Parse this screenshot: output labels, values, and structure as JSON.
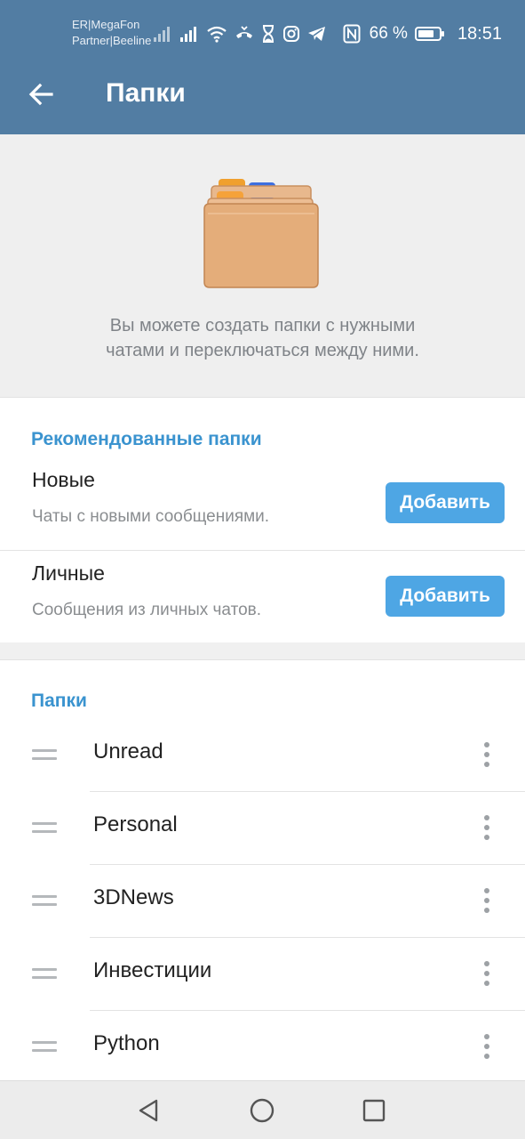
{
  "status_bar": {
    "carrier_line1": "ER|MegaFon",
    "carrier_line2": "Partner|Beeline",
    "battery_percent": "66 %",
    "time": "18:51",
    "icons": [
      "signal-r-icon",
      "signal-r-icon",
      "wifi-icon",
      "call-icon",
      "hourglass-icon",
      "instagram-icon",
      "telegram-icon",
      "nfc-icon",
      "battery-icon"
    ]
  },
  "header": {
    "title": "Папки",
    "back_icon": "arrow-left-icon",
    "background_color": "#527da3"
  },
  "hero": {
    "illustration": "folders-illustration",
    "text_line1": "Вы можете создать папки с нужными",
    "text_line2": "чатами и переключаться между ними."
  },
  "recommended": {
    "title": "Рекомендованные папки",
    "items": [
      {
        "name": "Новые",
        "description": "Чаты с новыми сообщениями.",
        "button": "Добавить"
      },
      {
        "name": "Личные",
        "description": "Сообщения из личных чатов.",
        "button": "Добавить"
      }
    ]
  },
  "folders": {
    "title": "Папки",
    "items": [
      {
        "name": "Unread"
      },
      {
        "name": "Personal"
      },
      {
        "name": "3DNews"
      },
      {
        "name": "Инвестиции"
      },
      {
        "name": "Python"
      }
    ]
  },
  "navigation_bar": {
    "buttons": [
      "back-triangle-icon",
      "home-circle-icon",
      "recents-square-icon"
    ]
  },
  "colors": {
    "accent": "#3a93cf",
    "button": "#4ea6e4"
  }
}
